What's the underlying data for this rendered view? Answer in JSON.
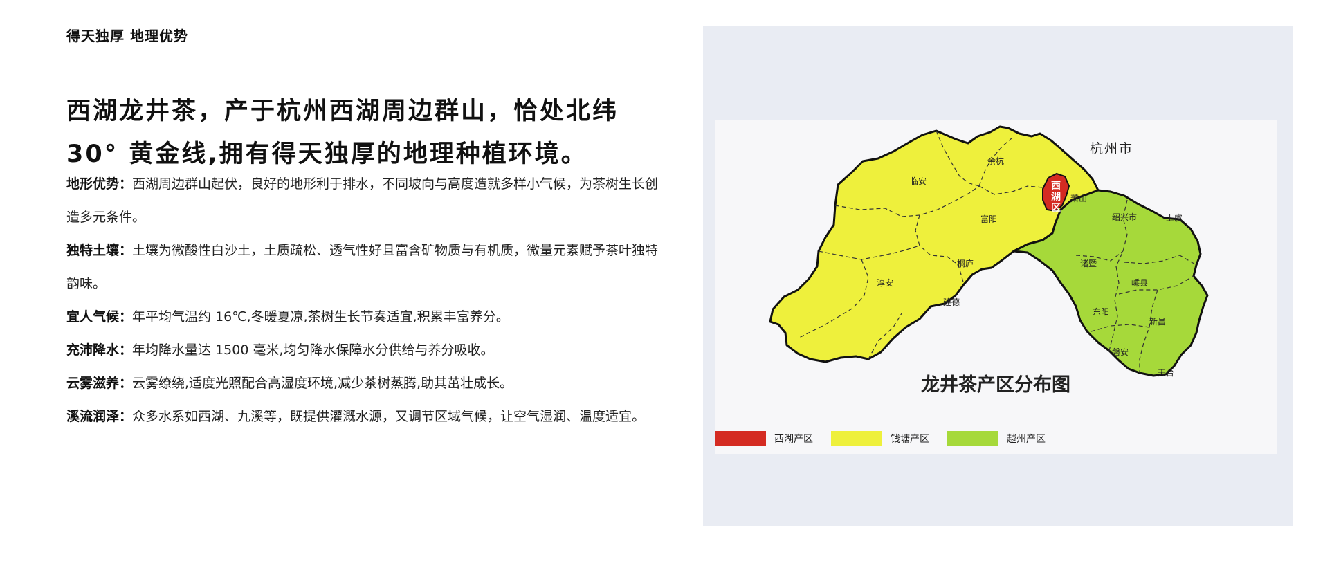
{
  "header": {
    "title": "得天独厚 地理优势"
  },
  "headline": {
    "line1": "西湖龙井茶，产于杭州西湖周边群山，恰处北纬",
    "line2": "30° 黄金线,拥有得天独厚的地理种植环境。"
  },
  "points": [
    {
      "label": "地形优势：",
      "text": "西湖周边群山起伏，良好的地形利于排水，不同坡向与高度造就多样小气候，为茶树生长创造多元条件。"
    },
    {
      "label": "独特土壤：",
      "text": "土壤为微酸性白沙土，土质疏松、透气性好且富含矿物质与有机质，微量元素赋予茶叶独特韵味。"
    },
    {
      "label": "宜人气候：",
      "text": "年平均气温约 16℃,冬暖夏凉,茶树生长节奏适宜,积累丰富养分。"
    },
    {
      "label": "充沛降水：",
      "text": "年均降水量达 1500 毫米,均匀降水保障水分供给与养分吸收。"
    },
    {
      "label": "云雾滋养：",
      "text": "云雾缭绕,适度光照配合高湿度环境,减少茶树蒸腾,助其茁壮成长。"
    },
    {
      "label": "溪流润泽：",
      "text": "众多水系如西湖、九溪等，既提供灌溉水源，又调节区域气候，让空气湿润、温度适宜。"
    }
  ],
  "map": {
    "city_label": "杭州市",
    "title": "龙井茶产区分布图",
    "west_lake_label": [
      "西",
      "湖",
      "区"
    ],
    "places": {
      "yuhang": "余杭",
      "linan": "临安",
      "xiaoshan": "萧山",
      "fuyang": "富阳",
      "tonglu": "桐庐",
      "chunan": "淳安",
      "jiande": "建德",
      "shaoxing": "绍兴市",
      "shangyu": "上虞",
      "zhuji": "诸暨",
      "shengxian": "嵊县",
      "dongyang": "东阳",
      "xinchang": "新昌",
      "panan": "磐安",
      "tiantai": "天台"
    },
    "legend": [
      {
        "label": "西湖产区",
        "color": "#d42b22"
      },
      {
        "label": "钱塘产区",
        "color": "#eef03c"
      },
      {
        "label": "越州产区",
        "color": "#a6d93a"
      }
    ],
    "colors": {
      "panel_bg": "#e9ecf3",
      "qiantang": "#eef03c",
      "yuezhou": "#a6d93a",
      "xihu": "#d42b22"
    }
  }
}
